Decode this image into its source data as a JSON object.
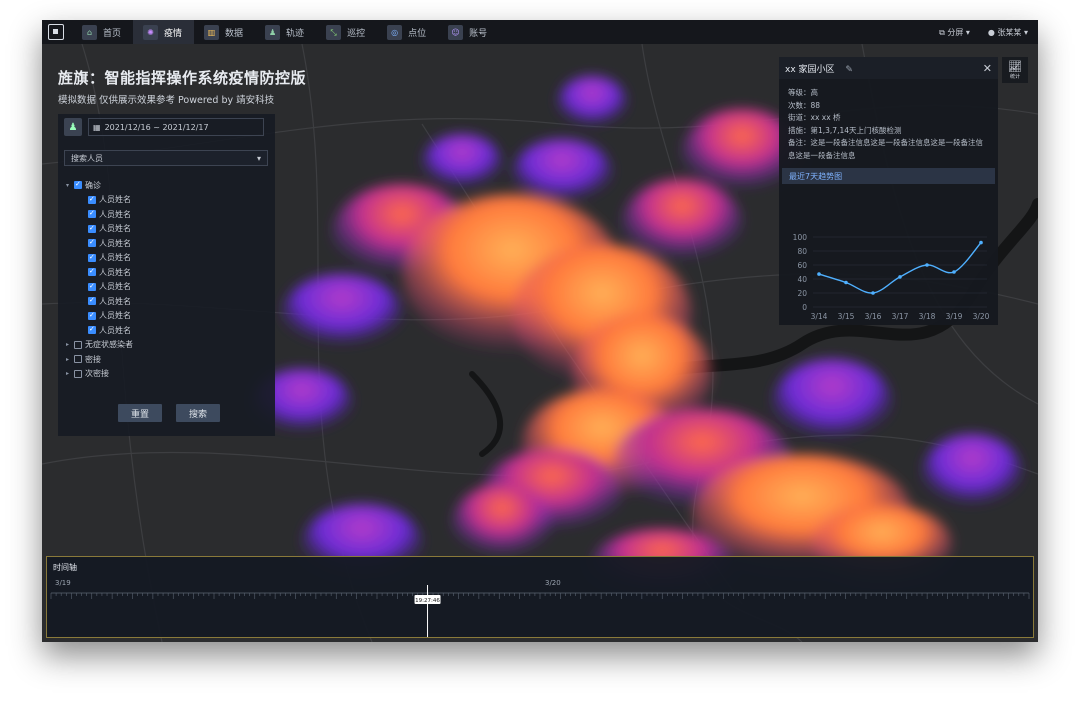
{
  "topbar": {
    "logo_icon": "scan-frame-icon",
    "nav": [
      {
        "label": "首页",
        "icon": "home-icon",
        "active": false
      },
      {
        "label": "疫情",
        "icon": "virus-icon",
        "active": true
      },
      {
        "label": "数据",
        "icon": "bar-chart-icon",
        "active": false
      },
      {
        "label": "轨迹",
        "icon": "person-track-icon",
        "active": false
      },
      {
        "label": "巡控",
        "icon": "route-icon",
        "active": false
      },
      {
        "label": "点位",
        "icon": "target-icon",
        "active": false
      },
      {
        "label": "账号",
        "icon": "user-account-icon",
        "active": false
      }
    ],
    "split_label": "分屏",
    "user_name": "张某某"
  },
  "header": {
    "title": "旌旗：智能指挥操作系统疫情防控版",
    "subtitle": "模拟数据 仅供展示效果参考 Powered by 靖安科技"
  },
  "filter": {
    "date_range": "2021/12/16  ~  2021/12/17",
    "search_placeholder": "搜索人员",
    "groups": [
      {
        "label": "确诊",
        "checked": true,
        "expanded": true,
        "children": [
          "人员姓名",
          "人员姓名",
          "人员姓名",
          "人员姓名",
          "人员姓名",
          "人员姓名",
          "人员姓名",
          "人员姓名",
          "人员姓名",
          "人员姓名"
        ]
      },
      {
        "label": "无症状感染者",
        "checked": false,
        "expanded": false
      },
      {
        "label": "密接",
        "checked": false,
        "expanded": false
      },
      {
        "label": "次密接",
        "checked": false,
        "expanded": false
      }
    ],
    "reset_label": "重置",
    "search_label": "搜索"
  },
  "info_panel": {
    "title": "xx 家园小区",
    "fields": [
      "等级：高",
      "次数：88",
      "街道：xx xx 桥",
      "措施：第1,3,7,14天上门核酸检测",
      "备注：这是一段备注信息这是一段备注信息这是一段备注信息这是一段备注信息"
    ],
    "trend_title": "最近7天趋势图"
  },
  "side_button": {
    "label": "统计"
  },
  "timeline": {
    "title": "时间轴",
    "day_labels": [
      "3/19",
      "3/20"
    ],
    "current_time": "19:27:46",
    "current_position": 0.385
  },
  "chart_data": {
    "type": "line",
    "categories": [
      "3/14",
      "3/15",
      "3/16",
      "3/17",
      "3/18",
      "3/19",
      "3/20"
    ],
    "values": [
      47,
      35,
      20,
      43,
      60,
      50,
      92
    ],
    "ylim": [
      0,
      100
    ],
    "yticks": [
      0,
      20,
      40,
      60,
      80,
      100
    ],
    "color": "#4fb0ff"
  },
  "colors": {
    "accent": "#3a8dff",
    "heat_low": "#6a2bd6",
    "heat_high": "#ff8a3d",
    "background": "#2a2b2d"
  }
}
